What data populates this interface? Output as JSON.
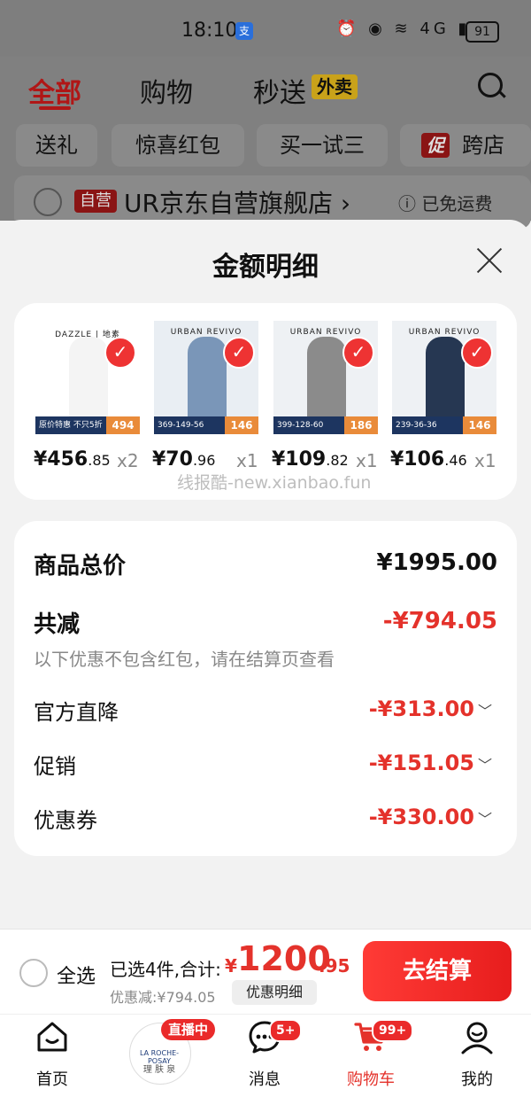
{
  "status_bar": {
    "time": "18:10",
    "alipay": "支",
    "battery": "91",
    "icons": "⏰ ◉ ≋ 4G ▮"
  },
  "background_page": {
    "tabs": [
      "全部",
      "购物",
      "秒送"
    ],
    "waimai_tag": "外卖",
    "chips": [
      "送礼",
      "惊喜红包",
      "买一试三",
      "跨店"
    ],
    "cu_tag": "促",
    "store_tag": "自营",
    "store_name": "UR京东自营旗舰店 ›",
    "free_shipping": "ⓘ 已免运费"
  },
  "sheet": {
    "title": "金额明细",
    "watermark": "线报酷-new.xianbao.fun",
    "products": [
      {
        "brand": "DAZZLE | 地素",
        "price_int": "¥456",
        "price_dec": ".85",
        "qty": "x2",
        "tag": "494",
        "strip": "原价特惠 不只5折",
        "figure_color": "#f4f4f4",
        "color": "#ffffff"
      },
      {
        "brand": "URBAN REVIVO",
        "price_int": "¥70",
        "price_dec": ".96",
        "qty": "x1",
        "tag": "146",
        "strip": "369-149-56",
        "figure_color": "#7a96b8",
        "color": "#e9eef3"
      },
      {
        "brand": "URBAN REVIVO",
        "price_int": "¥109",
        "price_dec": ".82",
        "qty": "x1",
        "tag": "186",
        "strip": "399-128-60",
        "figure_color": "#8b8b8b",
        "color": "#eef1f4"
      },
      {
        "brand": "URBAN REVIVO",
        "price_int": "¥106",
        "price_dec": ".46",
        "qty": "x1",
        "tag": "146",
        "strip": "239-36-36",
        "figure_color": "#263752",
        "color": "#eef1f4"
      }
    ],
    "summary": {
      "total_label": "商品总价",
      "total_value": "¥1995.00",
      "reduce_label": "共减",
      "reduce_value": "-¥794.05",
      "note": "以下优惠不包含红包，请在结算页查看",
      "rows": [
        {
          "label": "官方直降",
          "value": "-¥313.00"
        },
        {
          "label": "促销",
          "value": "-¥151.05"
        },
        {
          "label": "优惠券",
          "value": "-¥330.00"
        }
      ]
    }
  },
  "checkout": {
    "select_all": "全选",
    "selected": "已选4件,合计:",
    "yen": "¥",
    "total_int": "1200",
    "total_dec": ".95",
    "discount": "优惠减:¥794.05",
    "detail_button": "优惠明细",
    "settle_button": "去结算"
  },
  "nav": {
    "items": [
      {
        "label": "首页"
      },
      {
        "label": ""
      },
      {
        "label": "消息",
        "badge": "5+"
      },
      {
        "label": "购物车",
        "badge": "99+",
        "active": true,
        "color": "#e4322b"
      },
      {
        "label": "我的"
      }
    ],
    "live_badge": "直播中",
    "live_brand": "LA ROCHE-POSAY",
    "live_brand_cn": "理 肤 泉"
  }
}
